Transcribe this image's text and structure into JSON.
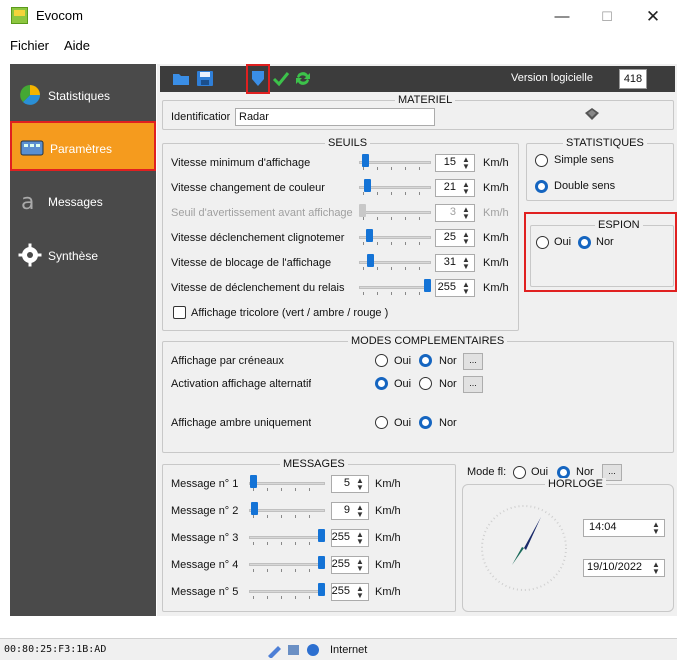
{
  "window": {
    "title": "Evocom",
    "min": "—",
    "max": "☐",
    "close": "✕"
  },
  "menu": [
    "Fichier",
    "Aide"
  ],
  "sidebar": {
    "items": [
      {
        "label": "Statistiques",
        "icon": "stats-icon"
      },
      {
        "label": "Paramètres",
        "icon": "parameters-icon",
        "active": true
      },
      {
        "label": "Messages",
        "icon": "messages-icon"
      },
      {
        "label": "Synthèse",
        "icon": "synthesis-icon"
      }
    ]
  },
  "toolbar": {
    "version_label": "Version logicielle",
    "version_value": "418",
    "icons": [
      "open-folder-icon",
      "save-icon",
      "download-icon",
      "check-icon",
      "refresh-icon"
    ]
  },
  "materiel": {
    "title": "MATERIEL",
    "id_label": "Identificatior",
    "id_value": "Radar"
  },
  "seuils": {
    "title": "SEUILS",
    "rows": [
      {
        "label": "Vitesse minimum d'affichage",
        "value": "15",
        "unit": "Km/h",
        "level": 0.05
      },
      {
        "label": "Vitesse changement de couleur",
        "value": "21",
        "unit": "Km/h",
        "level": 0.08
      },
      {
        "label": "Seuil d'avertissement avant affichage",
        "value": "3",
        "unit": "Km/h",
        "level": 0.0,
        "disabled": true
      },
      {
        "label": "Vitesse déclenchement clignotemer",
        "value": "25",
        "unit": "Km/h",
        "level": 0.1
      },
      {
        "label": "Vitesse de blocage de l'affichage",
        "value": "31",
        "unit": "Km/h",
        "level": 0.12
      },
      {
        "label": "Vitesse de déclenchement du relais",
        "value": "255",
        "unit": "Km/h",
        "level": 1.0
      }
    ],
    "tricolor_label": "Affichage tricolore (vert / ambre / rouge )"
  },
  "statistiques": {
    "title": "STATISTIQUES",
    "simple": "Simple sens",
    "double": "Double sens"
  },
  "espion": {
    "title": "ESPION",
    "oui": "Oui",
    "non": "Nor"
  },
  "modes": {
    "title": "MODES COMPLEMENTAIRES",
    "rows": [
      {
        "label": "Affichage par créneaux",
        "oui": "Oui",
        "non": "Nor",
        "selected": "non",
        "more": "..."
      },
      {
        "label": "Activation affichage alternatif",
        "oui": "Oui",
        "non": "Nor",
        "selected": "oui",
        "more": "..."
      },
      {
        "label": "Affichage ambre uniquement",
        "oui": "Oui",
        "non": "Nor",
        "selected": "non"
      }
    ]
  },
  "messages": {
    "title": "MESSAGES",
    "rows": [
      {
        "label": "Message n° 1",
        "value": "5",
        "unit": "Km/h",
        "level": 0.02
      },
      {
        "label": "Message n° 2",
        "value": "9",
        "unit": "Km/h",
        "level": 0.03
      },
      {
        "label": "Message n° 3",
        "value": "255",
        "unit": "Km/h",
        "level": 1.0
      },
      {
        "label": "Message n° 4",
        "value": "255",
        "unit": "Km/h",
        "level": 1.0
      },
      {
        "label": "Message n° 5",
        "value": "255",
        "unit": "Km/h",
        "level": 1.0
      }
    ]
  },
  "mode_flash": {
    "label": "Mode fl:",
    "oui": "Oui",
    "non": "Nor",
    "more": "..."
  },
  "horloge": {
    "title": "HORLOGE",
    "time": "14:04",
    "date": "19/10/2022"
  },
  "status": {
    "mac": "00:80:25:F3:1B:AD",
    "network": "Internet"
  }
}
